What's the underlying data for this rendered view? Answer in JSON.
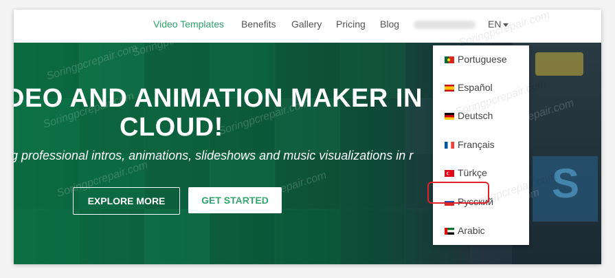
{
  "navbar": {
    "links": [
      {
        "label": "Video Templates",
        "active": true
      },
      {
        "label": "Benefits"
      },
      {
        "label": "Gallery"
      },
      {
        "label": "Pricing"
      },
      {
        "label": "Blog"
      }
    ],
    "language": "EN"
  },
  "hero": {
    "title_line1": "DEO AND ANIMATION MAKER IN",
    "title_line2": "CLOUD!",
    "subtitle": "g professional intros, animations, slideshows and music visualizations in r",
    "explore_label": "EXPLORE MORE",
    "start_label": "GET STARTED"
  },
  "languages": [
    {
      "label": "Portuguese",
      "flag": "portugal-flag-icon"
    },
    {
      "label": "Español",
      "flag": "spain-flag-icon"
    },
    {
      "label": "Deutsch",
      "flag": "germany-flag-icon"
    },
    {
      "label": "Français",
      "flag": "france-flag-icon"
    },
    {
      "label": "Türkçe",
      "flag": "turkey-flag-icon"
    },
    {
      "label": "Русский",
      "flag": "russia-flag-icon",
      "highlighted": true
    },
    {
      "label": "Arabic",
      "flag": "arabic-flag-icon"
    }
  ],
  "watermark_text": "Soringpcrepair.com",
  "colors": {
    "accent": "#2fa36b",
    "highlight": "#e32128",
    "hero": "#0b6b40"
  }
}
